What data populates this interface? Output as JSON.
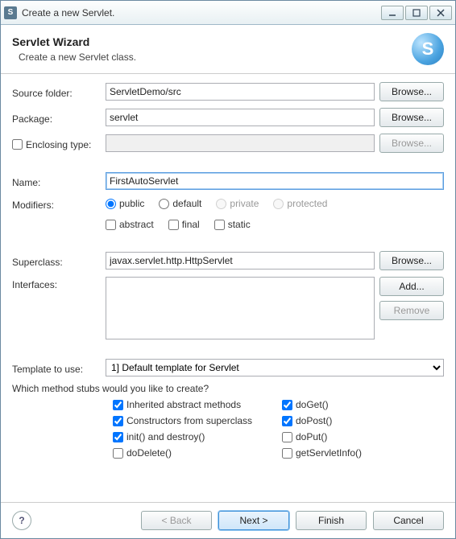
{
  "window": {
    "title": "Create a new Servlet."
  },
  "header": {
    "title": "Servlet Wizard",
    "subtitle": "Create a new Servlet class.",
    "logo_letter": "S"
  },
  "labels": {
    "source_folder": "Source folder:",
    "package": "Package:",
    "enclosing_type": "Enclosing type:",
    "name": "Name:",
    "modifiers": "Modifiers:",
    "superclass": "Superclass:",
    "interfaces": "Interfaces:",
    "template": "Template to use:",
    "stubs_question": "Which method stubs would you like to create?"
  },
  "fields": {
    "source_folder": "ServletDemo/src",
    "package": "servlet",
    "enclosing_type": "",
    "name": "FirstAutoServlet",
    "superclass": "javax.servlet.http.HttpServlet"
  },
  "modifiers_row1": [
    {
      "label": "public",
      "checked": true,
      "disabled": false
    },
    {
      "label": "default",
      "checked": false,
      "disabled": false
    },
    {
      "label": "private",
      "checked": false,
      "disabled": true
    },
    {
      "label": "protected",
      "checked": false,
      "disabled": true
    }
  ],
  "modifiers_row2": [
    {
      "label": "abstract",
      "checked": false
    },
    {
      "label": "final",
      "checked": false
    },
    {
      "label": "static",
      "checked": false
    }
  ],
  "template_selected": "1] Default template for Servlet",
  "stubs_col1": [
    {
      "label": "Inherited abstract methods",
      "checked": true
    },
    {
      "label": "Constructors from superclass",
      "checked": true
    },
    {
      "label": "init() and destroy()",
      "checked": true
    },
    {
      "label": "doDelete()",
      "checked": false
    }
  ],
  "stubs_col2": [
    {
      "label": "doGet()",
      "checked": true
    },
    {
      "label": "doPost()",
      "checked": true
    },
    {
      "label": "doPut()",
      "checked": false
    },
    {
      "label": "getServletInfo()",
      "checked": false
    }
  ],
  "buttons": {
    "browse": "Browse...",
    "add": "Add...",
    "remove": "Remove",
    "back": "< Back",
    "next": "Next >",
    "finish": "Finish",
    "cancel": "Cancel",
    "help": "?"
  }
}
